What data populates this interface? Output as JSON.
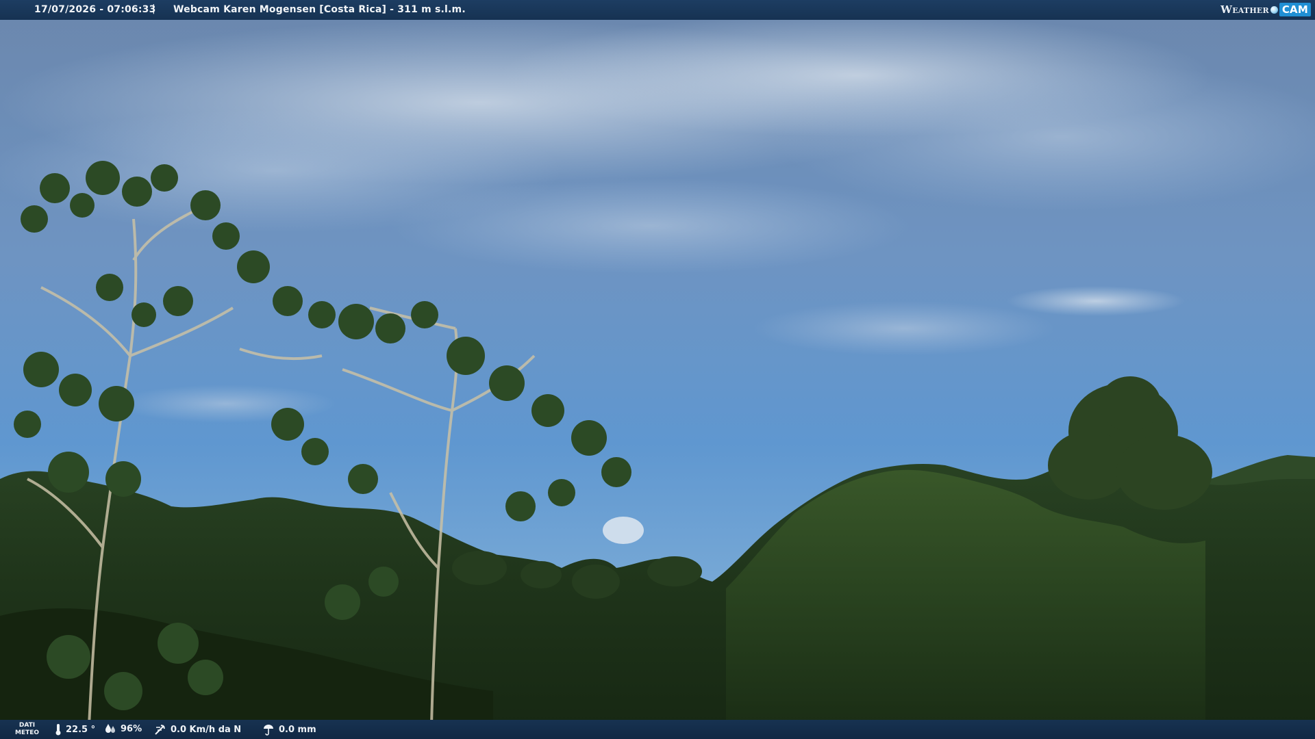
{
  "header": {
    "datetime": "17/07/2026 - 07:06:33",
    "separator": "|",
    "title": "Webcam Karen Mogensen [Costa Rica] - 311 m s.l.m.",
    "brand_left": "Weather",
    "brand_right": "CAM"
  },
  "footer": {
    "meteo_label_1": "DATI",
    "meteo_label_2": "METEO",
    "temperature": "22.5 °",
    "humidity": "96%",
    "wind": "0.0 Km/h da N",
    "rain": "0.0 mm",
    "icons": [
      "thermometer-icon",
      "humidity-icon",
      "wind-icon",
      "rain-icon"
    ]
  },
  "colors": {
    "sky_top": "#6f8fb4",
    "sky_bottom": "#5d95cf",
    "forest": "#1f3318",
    "bar": "#173251"
  }
}
